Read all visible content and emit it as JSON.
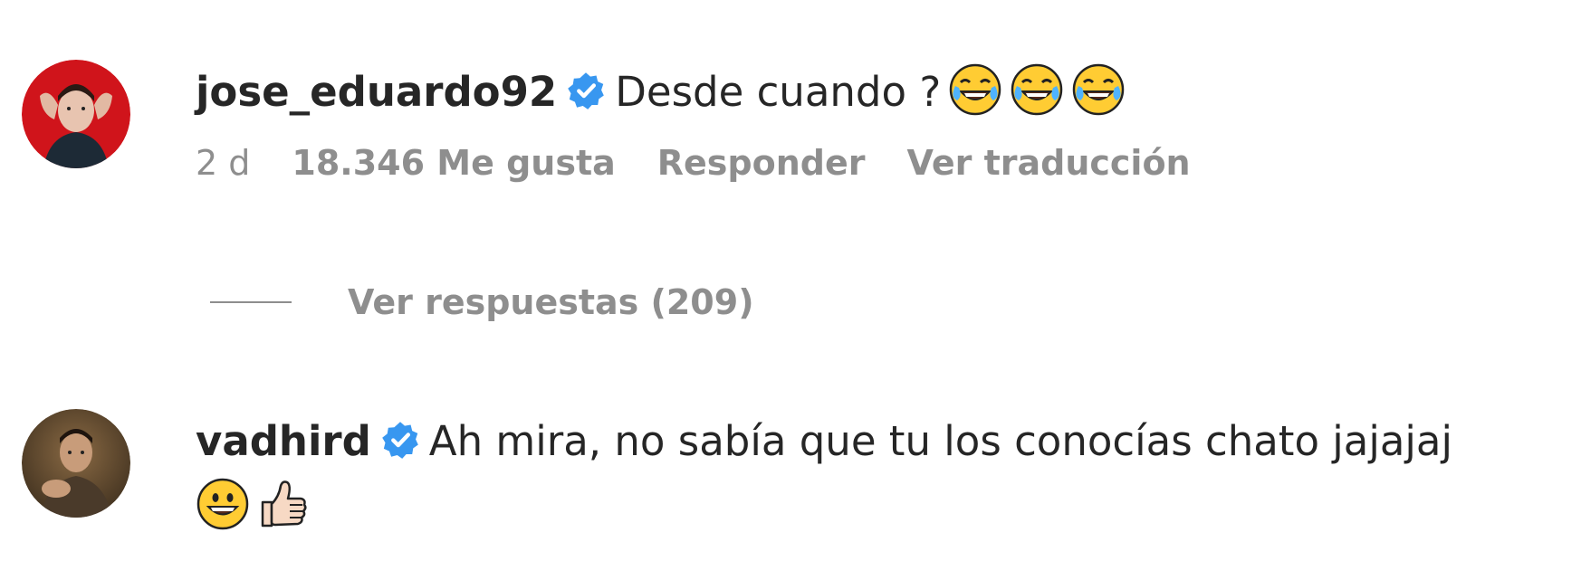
{
  "comments": [
    {
      "username": "jose_eduardo92",
      "verified": true,
      "text": "Desde cuando ?",
      "emojis": [
        "laughing-tears-emoji",
        "laughing-tears-emoji",
        "laughing-tears-emoji"
      ],
      "timestamp": "2 d",
      "likes": "18.346 Me gusta",
      "reply_label": "Responder",
      "translate_label": "Ver traducción",
      "view_replies": "Ver respuestas (209)"
    },
    {
      "username": "vadhird",
      "verified": true,
      "text": "Ah mira, no sabía que tu los conocías chato jajajaj",
      "emojis": [
        "grinning-face-emoji",
        "thumbs-up-emoji"
      ]
    }
  ],
  "colors": {
    "text_primary": "#262626",
    "text_secondary": "#8e8e8e",
    "verified_blue": "#3897f0"
  }
}
